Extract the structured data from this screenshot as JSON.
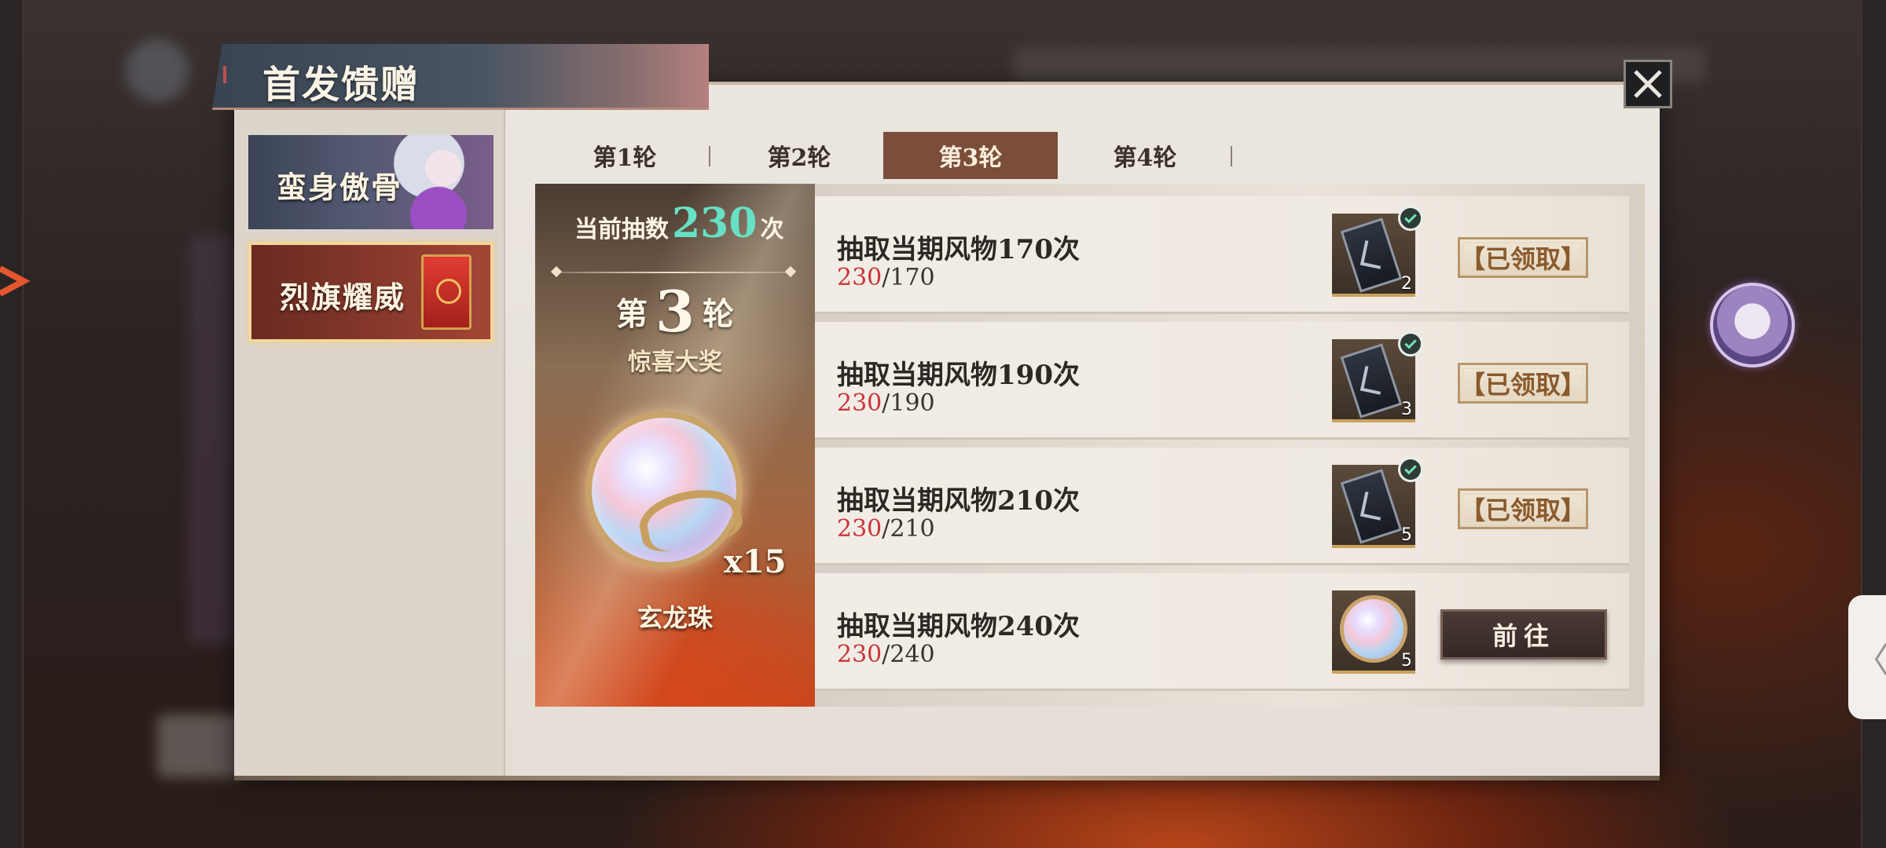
{
  "title": "首发馈赠",
  "sidebar": {
    "items": [
      {
        "label": "蛮身傲骨"
      },
      {
        "label": "烈旗耀威"
      }
    ]
  },
  "round_tabs": [
    "第1轮",
    "第2轮",
    "第3轮",
    "第4轮"
  ],
  "active_round": "第3轮",
  "prize_panel": {
    "draws_prefix": "当前抽数",
    "draws_value": "230",
    "draws_suffix": "次",
    "round_word_before": "第",
    "round_number": "3",
    "round_word_after": "轮",
    "subtitle": "惊喜大奖",
    "quantity": "x15",
    "item_name": "玄龙珠"
  },
  "tasks": [
    {
      "title": "抽取当期风物170次",
      "current": "230",
      "target": "/170",
      "reward_count": "2",
      "button": "【已领取】",
      "claimed": true
    },
    {
      "title": "抽取当期风物190次",
      "current": "230",
      "target": "/190",
      "reward_count": "3",
      "button": "【已领取】",
      "claimed": true
    },
    {
      "title": "抽取当期风物210次",
      "current": "230",
      "target": "/210",
      "reward_count": "5",
      "button": "【已领取】",
      "claimed": true
    },
    {
      "title": "抽取当期风物240次",
      "current": "230",
      "target": "/240",
      "reward_count": "5",
      "button": "前往",
      "claimed": false
    }
  ],
  "collapse_glyph": "〈",
  "icons": {
    "close": "close-icon",
    "check": "check-icon",
    "reward_scroll": "scroll-icon",
    "reward_orb": "orb-icon"
  },
  "colors": {
    "active_tab": "#7a4e3a",
    "progress_current": "#c9363a",
    "draws_value": "#68e0c6"
  }
}
